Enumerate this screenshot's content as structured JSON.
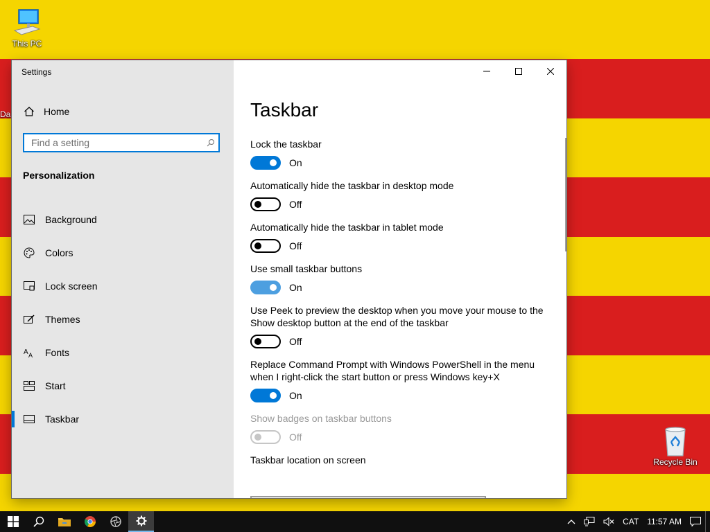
{
  "desktop": {
    "icons": [
      {
        "label": "This PC"
      },
      {
        "label": "Recycle Bin"
      }
    ],
    "clipped_label": "Da"
  },
  "window": {
    "title": "Settings",
    "sidebar": {
      "home_label": "Home",
      "search_placeholder": "Find a setting",
      "section_label": "Personalization",
      "items": [
        {
          "label": "Background",
          "icon": "picture-icon"
        },
        {
          "label": "Colors",
          "icon": "palette-icon"
        },
        {
          "label": "Lock screen",
          "icon": "lock-screen-icon"
        },
        {
          "label": "Themes",
          "icon": "brush-icon"
        },
        {
          "label": "Fonts",
          "icon": "font-icon"
        },
        {
          "label": "Start",
          "icon": "start-icon"
        },
        {
          "label": "Taskbar",
          "icon": "taskbar-icon",
          "active": true
        }
      ]
    },
    "content": {
      "title": "Taskbar",
      "settings": [
        {
          "label": "Lock the taskbar",
          "state": "On"
        },
        {
          "label": "Automatically hide the taskbar in desktop mode",
          "state": "Off"
        },
        {
          "label": "Automatically hide the taskbar in tablet mode",
          "state": "Off"
        },
        {
          "label": "Use small taskbar buttons",
          "state": "On"
        },
        {
          "label": "Use Peek to preview the desktop when you move your mouse to the Show desktop button at the end of the taskbar",
          "state": "Off"
        },
        {
          "label": "Replace Command Prompt with Windows PowerShell in the menu when I right-click the start button or press Windows key+X",
          "state": "On"
        },
        {
          "label": "Show badges on taskbar buttons",
          "state": "Off",
          "disabled": true
        },
        {
          "label": "Taskbar location on screen"
        }
      ]
    }
  },
  "taskbar": {
    "language": "CAT",
    "time": "11:57 AM"
  },
  "colors": {
    "accent": "#0078d7",
    "flag_yellow": "#f5d500",
    "flag_red": "#d91e1e",
    "taskbar": "#101010"
  }
}
